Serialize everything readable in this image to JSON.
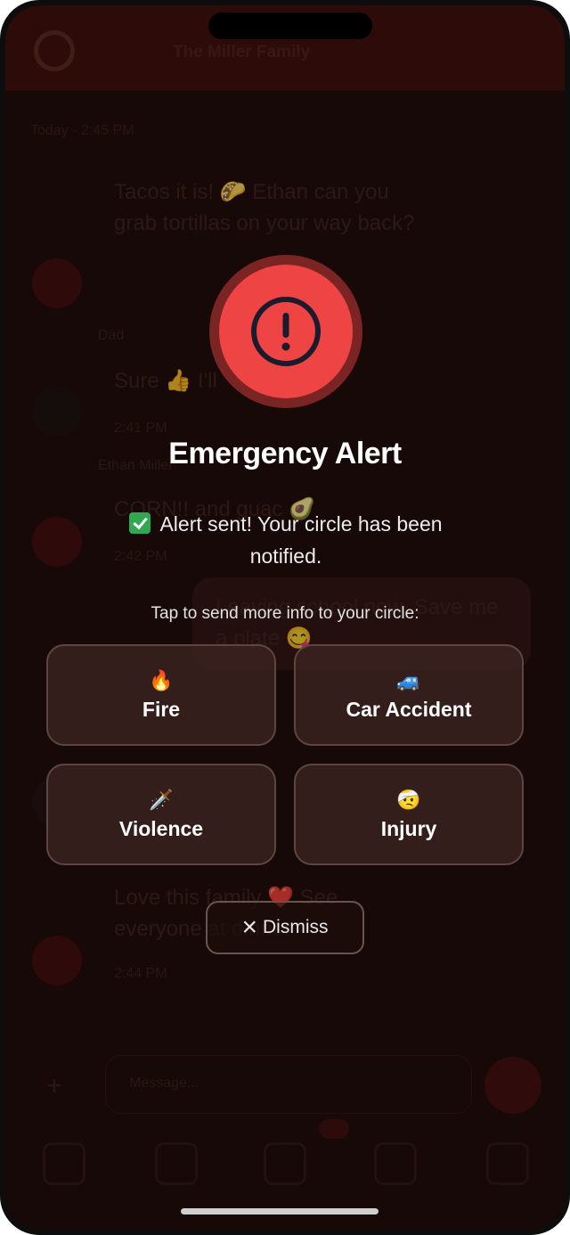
{
  "chat": {
    "circle_name": "The Miller Family",
    "sub_bar": "Today · 2:45 PM",
    "messages": [
      {
        "text": "Tacos it is! 🌮 Ethan can you grab tortillas on your way back?",
        "meta": ""
      },
      {
        "sender": "Dad",
        "text": "Sure 👍 I'll",
        "meta": "2:41 PM"
      },
      {
        "sender": "Ethan Miller",
        "text": "CORN!! and guac 🥑",
        "meta": "2:42 PM"
      },
      {
        "text": "Love this family ❤️ See everyone at dinner",
        "meta": "2:44 PM"
      }
    ],
    "outgoing_text": "Leaving school now. Save me a plate 😋",
    "composer_placeholder": "Message..."
  },
  "alert": {
    "title": "Emergency Alert",
    "sent_message": "Alert sent! Your circle has been notified.",
    "prompt": "Tap to send more info to your circle:",
    "options": [
      {
        "emoji": "🔥",
        "label": "Fire"
      },
      {
        "emoji": "🚙",
        "label": "Car Accident"
      },
      {
        "emoji": "🗡️",
        "label": "Violence"
      },
      {
        "emoji": "🤕",
        "label": "Injury"
      }
    ],
    "dismiss_label": "Dismiss",
    "dismiss_icon": "×"
  },
  "colors": {
    "alert_red": "#ef4444",
    "success_green": "#2fa84f"
  }
}
